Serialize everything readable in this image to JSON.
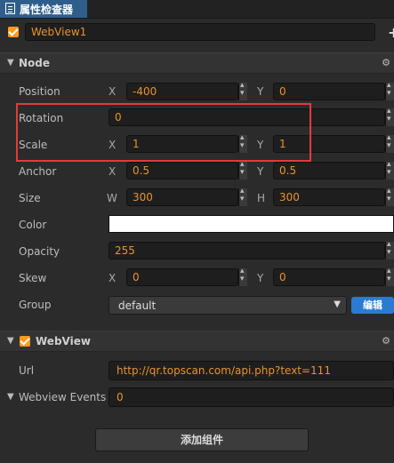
{
  "tab": {
    "label": "属性检查器"
  },
  "node_name": {
    "value": "WebView1",
    "enabled": true
  },
  "sections": {
    "node": {
      "title": "Node"
    },
    "webview": {
      "title": "WebView",
      "enabled": true
    }
  },
  "props": {
    "position": {
      "label": "Position",
      "x_axis": "X",
      "x": "-400",
      "y_axis": "Y",
      "y": "0"
    },
    "rotation": {
      "label": "Rotation",
      "value": "0"
    },
    "scale": {
      "label": "Scale",
      "x_axis": "X",
      "x": "1",
      "y_axis": "Y",
      "y": "1"
    },
    "anchor": {
      "label": "Anchor",
      "x_axis": "X",
      "x": "0.5",
      "y_axis": "Y",
      "y": "0.5"
    },
    "size": {
      "label": "Size",
      "w_axis": "W",
      "w": "300",
      "h_axis": "H",
      "h": "300"
    },
    "color": {
      "label": "Color",
      "value": "#ffffff"
    },
    "opacity": {
      "label": "Opacity",
      "value": "255"
    },
    "skew": {
      "label": "Skew",
      "x_axis": "X",
      "x": "0",
      "y_axis": "Y",
      "y": "0"
    },
    "group": {
      "label": "Group",
      "value": "default",
      "edit_label": "编辑"
    }
  },
  "webview": {
    "url_label": "Url",
    "url": "http://qr.topscan.com/api.php?text=111",
    "events_label": "Webview Events",
    "events_count": "0"
  },
  "add_component": {
    "label": "添加组件"
  },
  "colors": {
    "accent": "#e8932b",
    "checkbox": "#ff9a1a",
    "tab": "#2f5e8c",
    "edit_button": "#2a7bd2",
    "highlight": "#e53a3a"
  }
}
